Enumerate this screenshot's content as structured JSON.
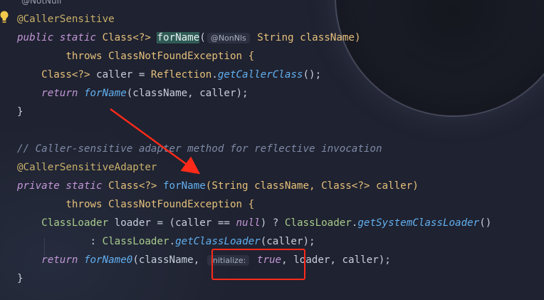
{
  "editor": {
    "top_hint": "@NotNull",
    "lines": [
      {
        "parts": [
          {
            "t": "@CallerSensitive",
            "c": "annot"
          }
        ]
      },
      {
        "parts": [
          {
            "t": "public static ",
            "c": "kw"
          },
          {
            "t": "Class<?> ",
            "c": "type"
          },
          {
            "t": "forName",
            "c": "hl-name"
          },
          {
            "t": "(",
            "c": "plain"
          },
          {
            "t": "@NonNls",
            "c": "hint"
          },
          {
            "t": " String className)",
            "c": "type"
          }
        ]
      },
      {
        "parts": [
          {
            "t": "        throws ",
            "c": "type"
          },
          {
            "t": "ClassNotFoundException {",
            "c": "type"
          }
        ]
      },
      {
        "parts": [
          {
            "t": "    Class<?> ",
            "c": "type"
          },
          {
            "t": "caller = ",
            "c": "plain"
          },
          {
            "t": "Reflection",
            "c": "type"
          },
          {
            "t": ".",
            "c": "plain"
          },
          {
            "t": "getCallerClass",
            "c": "fn-i"
          },
          {
            "t": "();",
            "c": "plain"
          }
        ]
      },
      {
        "parts": [
          {
            "t": "    return ",
            "c": "kw"
          },
          {
            "t": "forName",
            "c": "fn-i"
          },
          {
            "t": "(className, caller);",
            "c": "plain"
          }
        ]
      },
      {
        "parts": [
          {
            "t": "}",
            "c": "plain"
          }
        ]
      },
      {
        "parts": [
          {
            "t": "",
            "c": "plain"
          }
        ]
      },
      {
        "parts": [
          {
            "t": "// Caller-sensitive adapter method for reflective invocation",
            "c": "comment"
          }
        ]
      },
      {
        "parts": [
          {
            "t": "@CallerSensitiveAdapter",
            "c": "annot"
          }
        ]
      },
      {
        "parts": [
          {
            "t": "private static ",
            "c": "kw"
          },
          {
            "t": "Class<?> ",
            "c": "type"
          },
          {
            "t": "forName",
            "c": "fn"
          },
          {
            "t": "(String className, Class<?> caller)",
            "c": "type"
          }
        ]
      },
      {
        "parts": [
          {
            "t": "        throws ",
            "c": "type"
          },
          {
            "t": "ClassNotFoundException {",
            "c": "type"
          }
        ]
      },
      {
        "parts": [
          {
            "t": "    ClassLoader ",
            "c": "type-g"
          },
          {
            "t": "loader = (caller == ",
            "c": "plain"
          },
          {
            "t": "null",
            "c": "kw"
          },
          {
            "t": ") ? ",
            "c": "plain"
          },
          {
            "t": "ClassLoader",
            "c": "type-g"
          },
          {
            "t": ".",
            "c": "plain"
          },
          {
            "t": "getSystemClassLoader",
            "c": "fn-i"
          },
          {
            "t": "()",
            "c": "plain"
          }
        ]
      },
      {
        "parts": [
          {
            "t": "            : ",
            "c": "plain"
          },
          {
            "t": "ClassLoader",
            "c": "type-g"
          },
          {
            "t": ".",
            "c": "plain"
          },
          {
            "t": "getClassLoader",
            "c": "fn-i"
          },
          {
            "t": "(caller);",
            "c": "plain"
          }
        ]
      },
      {
        "parts": [
          {
            "t": "    return ",
            "c": "kw"
          },
          {
            "t": "forName0",
            "c": "fn-i"
          },
          {
            "t": "(className, ",
            "c": "plain"
          },
          {
            "t": "initialize:",
            "c": "hint"
          },
          {
            "t": " true",
            "c": "kw"
          },
          {
            "t": ", loader, caller);",
            "c": "plain"
          }
        ]
      },
      {
        "parts": [
          {
            "t": "}",
            "c": "plain"
          }
        ]
      }
    ]
  },
  "colors": {
    "background": "#1f2230",
    "annotation_box": "#ff2a1a",
    "arrow": "#ff2a1a"
  },
  "icons": {
    "gutter": "lightbulb-icon"
  }
}
